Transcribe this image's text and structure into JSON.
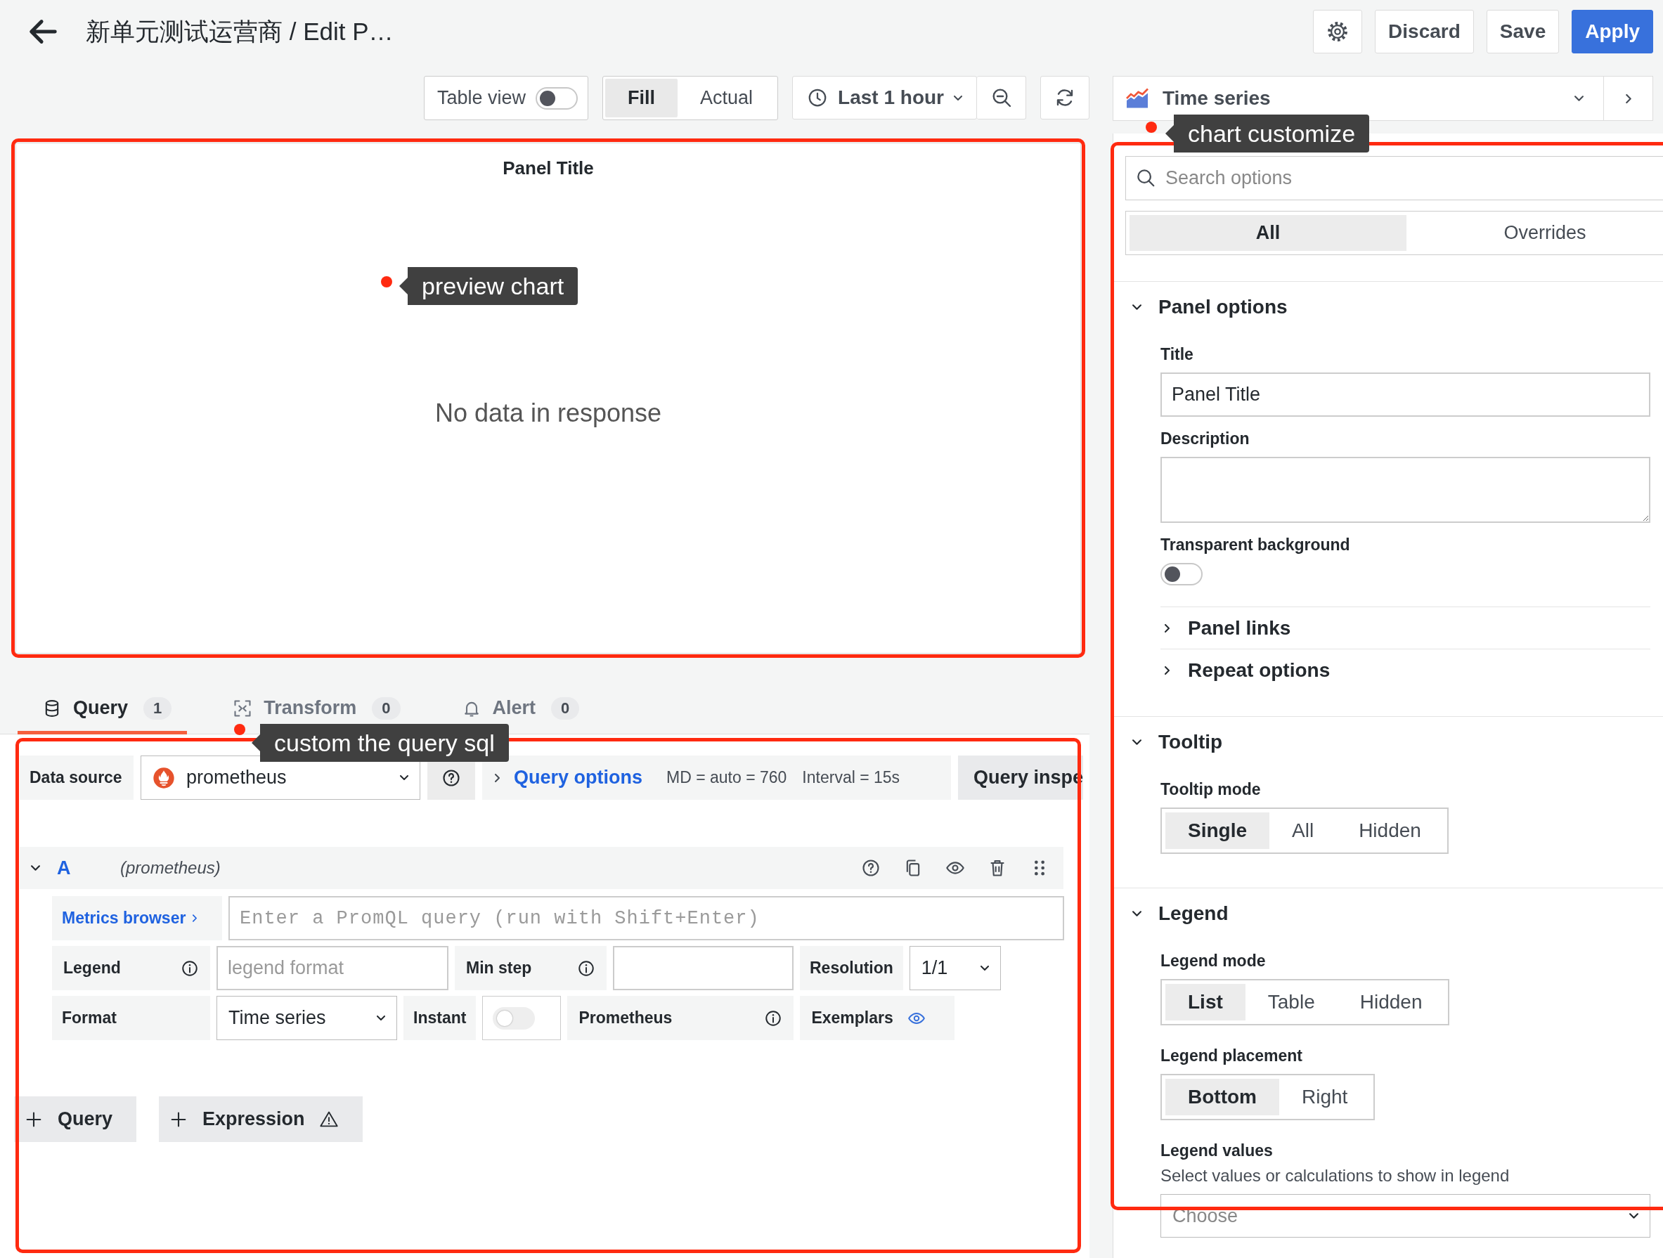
{
  "header": {
    "title": "新单元测试运营商 / Edit P…",
    "actions": [
      {
        "label": "Discard",
        "primary": false
      },
      {
        "label": "Save",
        "primary": false
      },
      {
        "label": "Apply",
        "primary": true
      }
    ]
  },
  "toolbar": {
    "table_view": {
      "label": "Table view",
      "on": false
    },
    "display_modes": [
      {
        "label": "Fill",
        "selected": true
      },
      {
        "label": "Actual",
        "selected": false
      }
    ],
    "time_range": "Last 1 hour"
  },
  "visualization": {
    "label": "Time series"
  },
  "preview": {
    "title": "Panel Title",
    "message": "No data in response"
  },
  "query_tabs": [
    {
      "label": "Query",
      "count": "1",
      "selected": true
    },
    {
      "label": "Transform",
      "count": "0",
      "selected": false
    },
    {
      "label": "Alert",
      "count": "0",
      "selected": false
    }
  ],
  "query_bar": {
    "data_source_label": "Data source",
    "data_source": "prometheus",
    "options_label": "Query options",
    "md": "MD = auto = 760",
    "interval": "Interval = 15s",
    "inspector": "Query inspe"
  },
  "query": {
    "ref": "A",
    "source": "(prometheus)",
    "expanded": true,
    "metrics_browser": "Metrics browser",
    "placeholder": "Enter a PromQL query (run with Shift+Enter)",
    "legend_label": "Legend",
    "legend_placeholder": "legend format",
    "min_step_label": "Min step",
    "resolution_label": "Resolution",
    "resolution": "1/1",
    "format_label": "Format",
    "format": "Time series",
    "instant_label": "Instant",
    "instant": false,
    "type_label": "Prometheus",
    "exemplars_label": "Exemplars"
  },
  "add_buttons": [
    {
      "label": "Query",
      "warning": false
    },
    {
      "label": "Expression",
      "warning": true
    }
  ],
  "options": {
    "search_placeholder": "Search options",
    "tabs": [
      {
        "label": "All",
        "selected": true
      },
      {
        "label": "Overrides",
        "selected": false
      }
    ],
    "sections": [
      {
        "title": "Panel options",
        "expanded": true,
        "items": [
          {
            "kind": "text",
            "label": "Title",
            "value": "Panel Title"
          },
          {
            "kind": "textarea",
            "label": "Description"
          },
          {
            "kind": "switch",
            "label": "Transparent background",
            "on": false
          },
          {
            "kind": "group",
            "label": "Panel links",
            "expanded": false
          },
          {
            "kind": "group",
            "label": "Repeat options",
            "expanded": false
          }
        ]
      },
      {
        "title": "Tooltip",
        "expanded": true,
        "items": [
          {
            "kind": "radio",
            "label": "Tooltip mode",
            "options": [
              {
                "label": "Single",
                "selected": true
              },
              {
                "label": "All",
                "selected": false
              },
              {
                "label": "Hidden",
                "selected": false
              }
            ]
          }
        ]
      },
      {
        "title": "Legend",
        "expanded": true,
        "items": [
          {
            "kind": "radio",
            "label": "Legend mode",
            "options": [
              {
                "label": "List",
                "selected": true
              },
              {
                "label": "Table",
                "selected": false
              },
              {
                "label": "Hidden",
                "selected": false
              }
            ]
          },
          {
            "kind": "radio",
            "label": "Legend placement",
            "options": [
              {
                "label": "Bottom",
                "selected": true
              },
              {
                "label": "Right",
                "selected": false
              }
            ]
          },
          {
            "kind": "select",
            "label": "Legend values",
            "description": "Select values or calculations to show in legend",
            "placeholder": "Choose"
          }
        ]
      }
    ]
  },
  "annotations": [
    {
      "text": "preview chart"
    },
    {
      "text": "chart customize"
    },
    {
      "text": "custom the query sql"
    }
  ]
}
